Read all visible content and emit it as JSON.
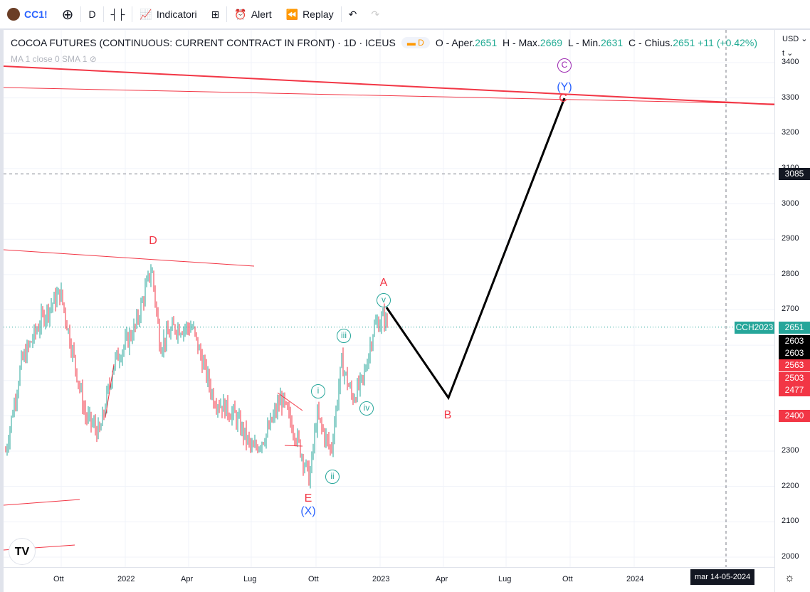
{
  "toolbar": {
    "symbol": "CC1!",
    "interval": "D",
    "indicators": "Indicatori",
    "alert": "Alert",
    "replay": "Replay"
  },
  "legend": {
    "title": "COCOA FUTURES (CONTINUOUS: CURRENT CONTRACT IN FRONT) · 1D · ICEUS",
    "badge": "D",
    "o_label": "O - Aper.",
    "o": "2651",
    "h_label": "H - Max.",
    "h": "2669",
    "l_label": "L - Min.",
    "l": "2631",
    "c_label": "C - Chius.",
    "c": "2651",
    "change": "+11 (+0.42%)",
    "ma": "MA 1 close 0 SMA 1"
  },
  "price_axis": {
    "currency": "USD",
    "unit": "t",
    "ticks": [
      "3400",
      "3300",
      "3200",
      "3100",
      "3000",
      "2900",
      "2800",
      "2700",
      "2600",
      "2500",
      "2400",
      "2300",
      "2200",
      "2100",
      "2000"
    ]
  },
  "price_labels": [
    {
      "text": "3085",
      "price": 3085,
      "color": "#131722"
    },
    {
      "text": "2651",
      "price": 2651,
      "color": "#26a69a",
      "tag": "CCH2023"
    },
    {
      "text": "2603",
      "price": 2612,
      "color": "#000000"
    },
    {
      "text": "2603",
      "price": 2578,
      "color": "#000000"
    },
    {
      "text": "2563",
      "price": 2543,
      "color": "#f23645"
    },
    {
      "text": "2503",
      "price": 2508,
      "color": "#f23645"
    },
    {
      "text": "2477",
      "price": 2473,
      "color": "#f23645"
    },
    {
      "text": "2400",
      "price": 2400,
      "color": "#f23645"
    }
  ],
  "time_axis": [
    "Ott",
    "2022",
    "Apr",
    "Lug",
    "Ott",
    "2023",
    "Apr",
    "Lug",
    "Ott",
    "2024"
  ],
  "crosshair_date": "mar 14-05-2024",
  "waves": {
    "D": "D",
    "E": "E",
    "X": "(X)",
    "A": "A",
    "B": "B",
    "C": "C",
    "Y": "(Y)",
    "Cc": "C",
    "i": "i",
    "ii": "ii",
    "iii": "iii",
    "iv": "iv",
    "v": "v"
  },
  "colors": {
    "up": "#26a69a",
    "down": "#f23645",
    "accent": "#2962ff"
  }
}
